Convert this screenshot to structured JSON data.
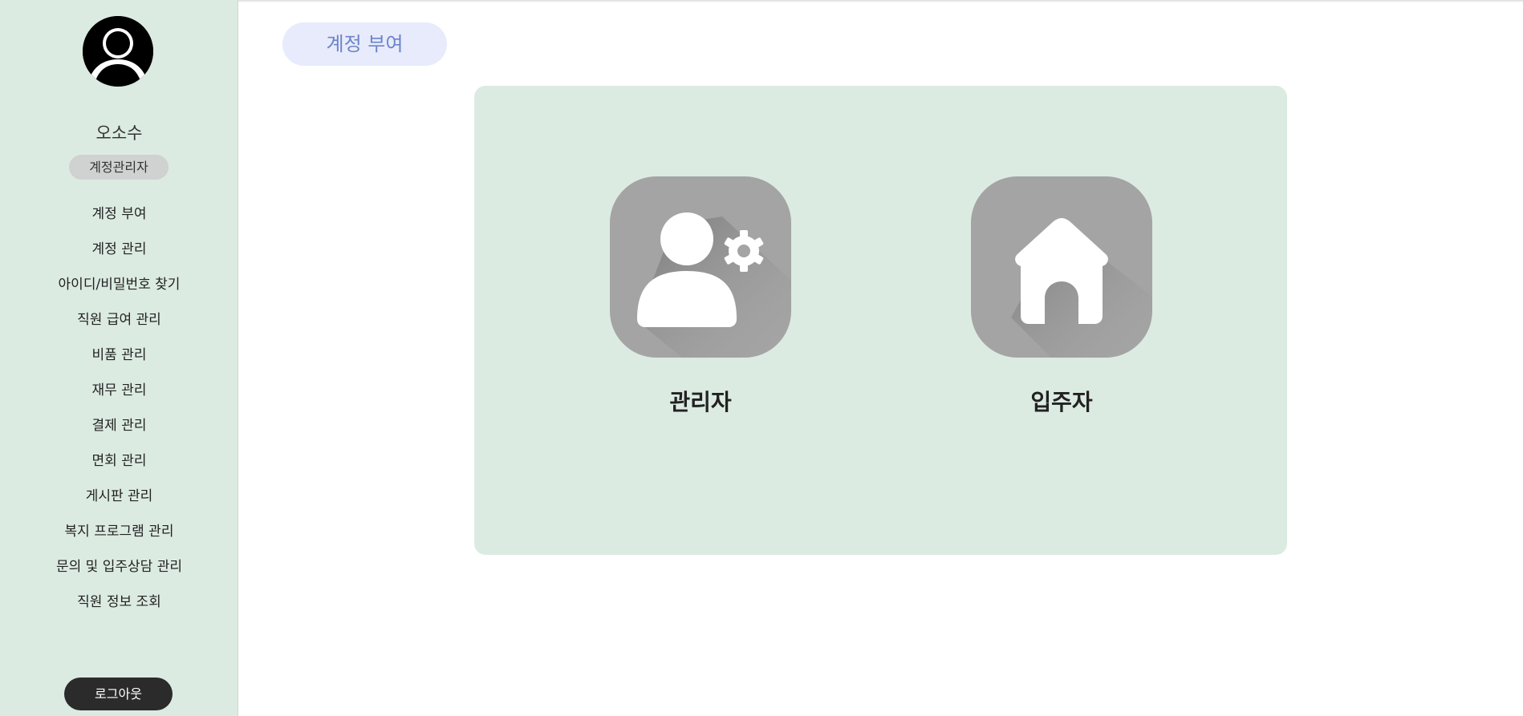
{
  "sidebar": {
    "user_name": "오소수",
    "role": "계정관리자",
    "menu": [
      "계정 부여",
      "계정 관리",
      "아이디/비밀번호 찾기",
      "직원 급여 관리",
      "비품 관리",
      "재무 관리",
      "결제 관리",
      "면회 관리",
      "게시판 관리",
      "복지 프로그램 관리",
      "문의 및 입주상담 관리",
      "직원 정보 조회"
    ],
    "logout_label": "로그아웃"
  },
  "header": {
    "page_title": "계정 부여"
  },
  "main": {
    "options": [
      {
        "label": "관리자",
        "icon": "admin-gear-icon"
      },
      {
        "label": "입주자",
        "icon": "house-icon"
      }
    ]
  },
  "colors": {
    "sidebar_bg": "#dcebe2",
    "panel_bg": "#dcebe2",
    "tab_bg": "#e7ebfb",
    "tab_text": "#6c84c9",
    "icon_bg": "#a4a4a4",
    "logout_bg": "#2b2b2b"
  }
}
